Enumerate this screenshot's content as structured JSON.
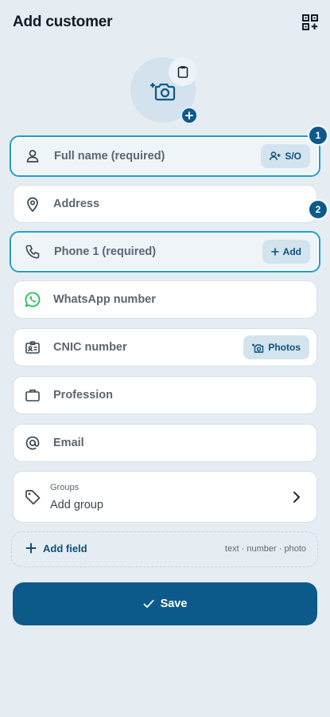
{
  "header": {
    "title": "Add customer",
    "scan_icon": "qr-add-icon"
  },
  "avatar": {
    "icon": "camera-plus-icon",
    "clip_icon": "clipboard-icon",
    "badge_icon": "plus-icon"
  },
  "fields": {
    "full_name": {
      "label": "Full name (required)",
      "icon": "person-icon",
      "chip": "S/O",
      "chip_icon": "person-plus-icon",
      "step": "1"
    },
    "address": {
      "label": "Address",
      "icon": "location-pin-icon"
    },
    "phone1": {
      "label": "Phone 1 (required)",
      "icon": "phone-icon",
      "chip": "Add",
      "chip_icon": "plus-icon",
      "step": "2"
    },
    "whatsapp": {
      "label": "WhatsApp number",
      "icon": "whatsapp-icon"
    },
    "cnic": {
      "label": "CNIC number",
      "icon": "id-card-icon",
      "chip": "Photos",
      "chip_icon": "camera-plus-icon"
    },
    "profession": {
      "label": "Profession",
      "icon": "briefcase-icon"
    },
    "email": {
      "label": "Email",
      "icon": "at-icon"
    }
  },
  "groups": {
    "label": "Groups",
    "value": "Add group",
    "icon": "tag-icon"
  },
  "add_field": {
    "label": "Add field",
    "hint": "text · number · photo"
  },
  "save": {
    "label": "Save"
  },
  "colors": {
    "background": "#e5edf3",
    "primary": "#0c5a8a",
    "highlight_border": "#1e9fd2",
    "chip_bg": "#d3e4ef",
    "whatsapp": "#25c05a"
  }
}
